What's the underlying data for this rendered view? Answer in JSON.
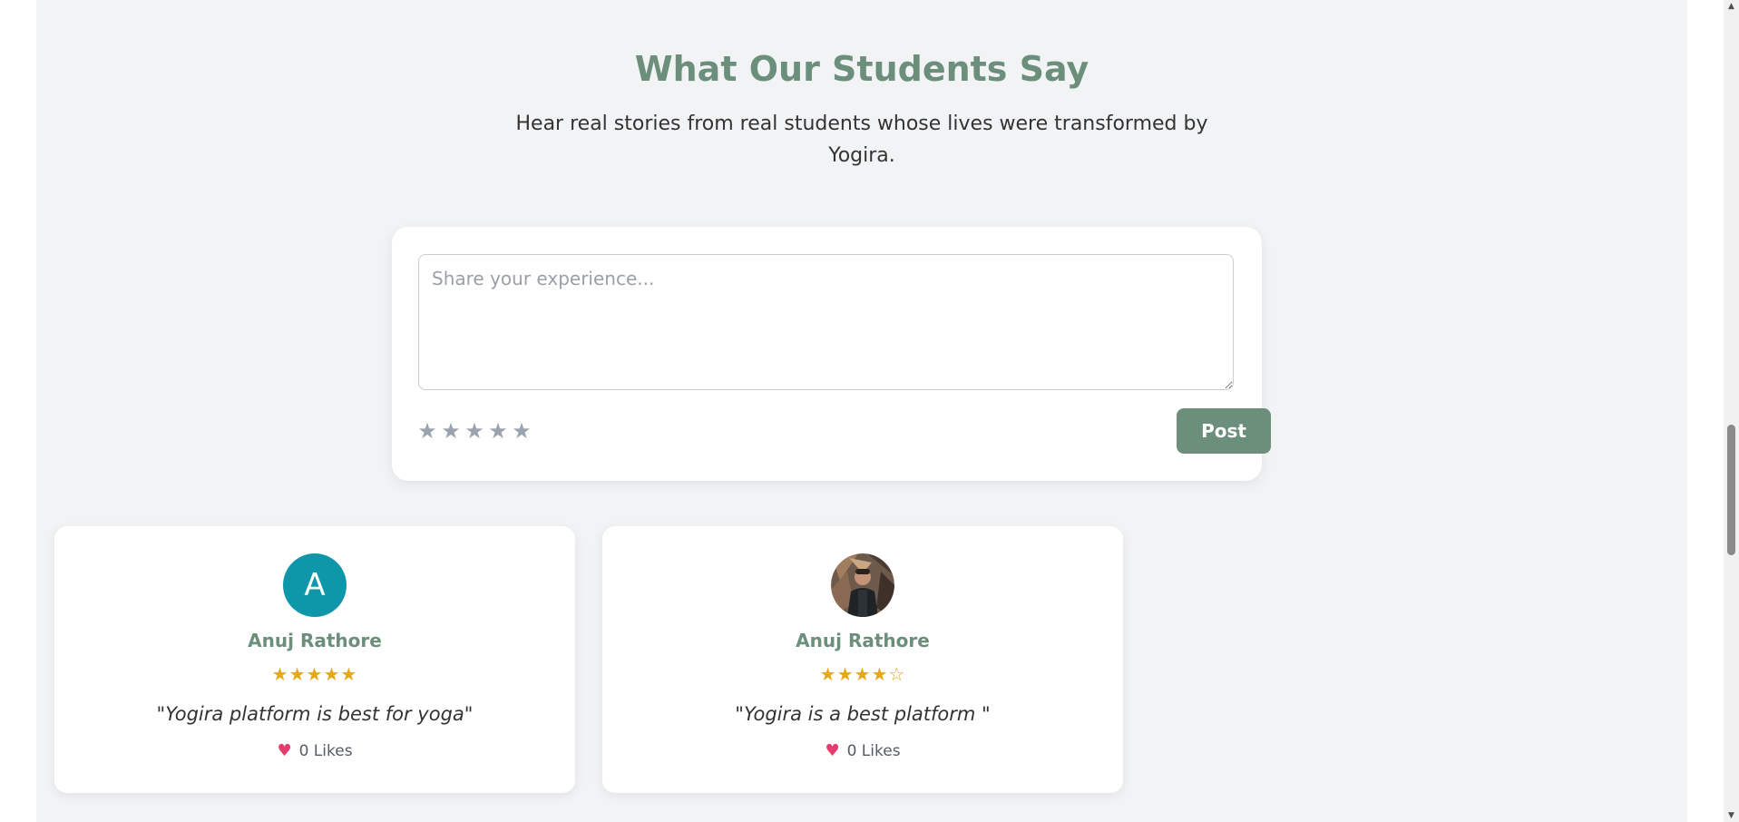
{
  "testimonials_section": {
    "title": "What Our Students Say",
    "subtitle": "Hear real stories from real students whose lives were transformed by Yogira."
  },
  "composer": {
    "placeholder": "Share your experience...",
    "value": "",
    "rating_stars": [
      "★",
      "★",
      "★",
      "★",
      "★"
    ],
    "rating_selected": 0,
    "post_label": "Post"
  },
  "cards": [
    {
      "avatar_type": "letter",
      "avatar_letter": "A",
      "avatar_color": "#0e97a8",
      "name": "Anuj Rathore",
      "stars": "★★★★★",
      "rating": 5,
      "quote": "\"Yogira platform is best for yoga\"",
      "likes": "0 Likes",
      "like_icon": "heart-icon"
    },
    {
      "avatar_type": "photo",
      "name": "Anuj Rathore",
      "stars": "★★★★☆",
      "rating": 4,
      "quote": "\"Yogira is a best platform \"",
      "likes": "0 Likes",
      "like_icon": "heart-icon"
    }
  ],
  "colors": {
    "accent": "#6b8f7b",
    "star_filled": "#e6a817",
    "star_empty": "#9aa3ae",
    "heart": "#e63b6f",
    "background": "#f2f3f5"
  }
}
